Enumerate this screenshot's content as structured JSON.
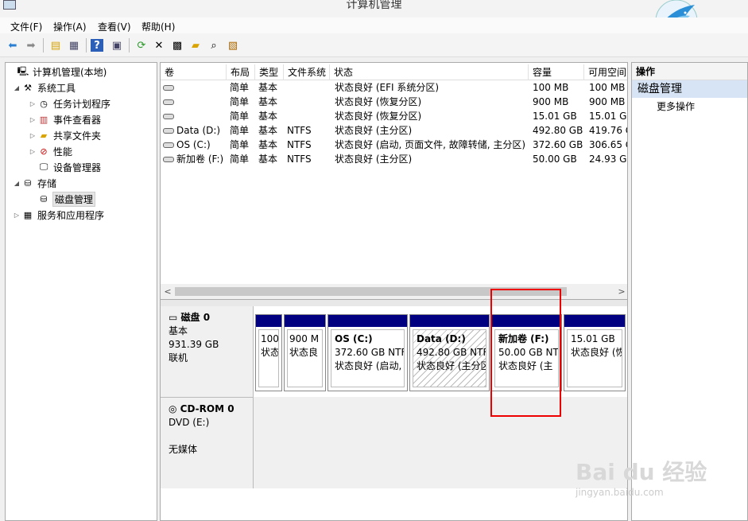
{
  "window": {
    "title": "计算机管理"
  },
  "menu": [
    "文件(F)",
    "操作(A)",
    "查看(V)",
    "帮助(H)"
  ],
  "toolbar_icons": [
    "back-icon",
    "forward-icon",
    "up-folder-icon",
    "show-hide-tree-icon",
    "help-icon",
    "console-view-icon",
    "refresh-icon",
    "delete-icon",
    "properties-icon",
    "open-icon",
    "search-icon",
    "settings-icon"
  ],
  "tree": [
    {
      "label": "计算机管理(本地)",
      "icon": "computer-icon",
      "expander": ""
    },
    {
      "label": "系统工具",
      "icon": "tools-icon",
      "expander": "◢"
    },
    {
      "label": "任务计划程序",
      "icon": "clock-icon",
      "expander": "▷"
    },
    {
      "label": "事件查看器",
      "icon": "event-viewer-icon",
      "expander": "▷"
    },
    {
      "label": "共享文件夹",
      "icon": "shared-folder-icon",
      "expander": "▷"
    },
    {
      "label": "性能",
      "icon": "performance-icon",
      "expander": "▷"
    },
    {
      "label": "设备管理器",
      "icon": "device-manager-icon",
      "expander": ""
    },
    {
      "label": "存储",
      "icon": "storage-icon",
      "expander": "◢"
    },
    {
      "label": "磁盘管理",
      "icon": "disk-management-icon",
      "expander": ""
    },
    {
      "label": "服务和应用程序",
      "icon": "services-icon",
      "expander": "▷"
    }
  ],
  "volume_table": {
    "columns": [
      "卷",
      "布局",
      "类型",
      "文件系统",
      "状态",
      "容量",
      "可用空间"
    ],
    "rows": [
      [
        "",
        "简单",
        "基本",
        "",
        "状态良好 (EFI 系统分区)",
        "100 MB",
        "100 MB"
      ],
      [
        "",
        "简单",
        "基本",
        "",
        "状态良好 (恢复分区)",
        "900 MB",
        "900 MB"
      ],
      [
        "",
        "简单",
        "基本",
        "",
        "状态良好 (恢复分区)",
        "15.01 GB",
        "15.01 GB"
      ],
      [
        "Data (D:)",
        "简单",
        "基本",
        "NTFS",
        "状态良好 (主分区)",
        "492.80 GB",
        "419.76 G"
      ],
      [
        "OS (C:)",
        "简单",
        "基本",
        "NTFS",
        "状态良好 (启动, 页面文件, 故障转储, 主分区)",
        "372.60 GB",
        "306.65 G"
      ],
      [
        "新加卷 (F:)",
        "简单",
        "基本",
        "NTFS",
        "状态良好 (主分区)",
        "50.00 GB",
        "24.93 GB"
      ]
    ]
  },
  "disk0": {
    "name": "磁盘 0",
    "type": "基本",
    "size": "931.39 GB",
    "status": "联机"
  },
  "partitions": [
    {
      "name": "",
      "size": "100",
      "status": "状态"
    },
    {
      "name": "",
      "size": "900 M",
      "status": "状态良"
    },
    {
      "name": "OS  (C:)",
      "size": "372.60 GB NTF",
      "status": "状态良好 (启动,"
    },
    {
      "name": "Data  (D:)",
      "size": "492.80 GB NTFS",
      "status": "状态良好 (主分区"
    },
    {
      "name": "新加卷  (F:)",
      "size": "50.00 GB NT",
      "status": "状态良好 (主"
    },
    {
      "name": "",
      "size": "15.01 GB",
      "status": "状态良好 (恢"
    }
  ],
  "cdrom": {
    "name": "CD-ROM 0",
    "drive": "DVD (E:)",
    "media": "无媒体"
  },
  "actions": {
    "header": "操作",
    "section": "磁盘管理",
    "more": "更多操作"
  },
  "watermark": {
    "brand": "Bai du 经验",
    "url": "jingyan.baidu.com"
  },
  "colors": {
    "partition_bar": "#000080",
    "highlight_box": "#e00000"
  }
}
